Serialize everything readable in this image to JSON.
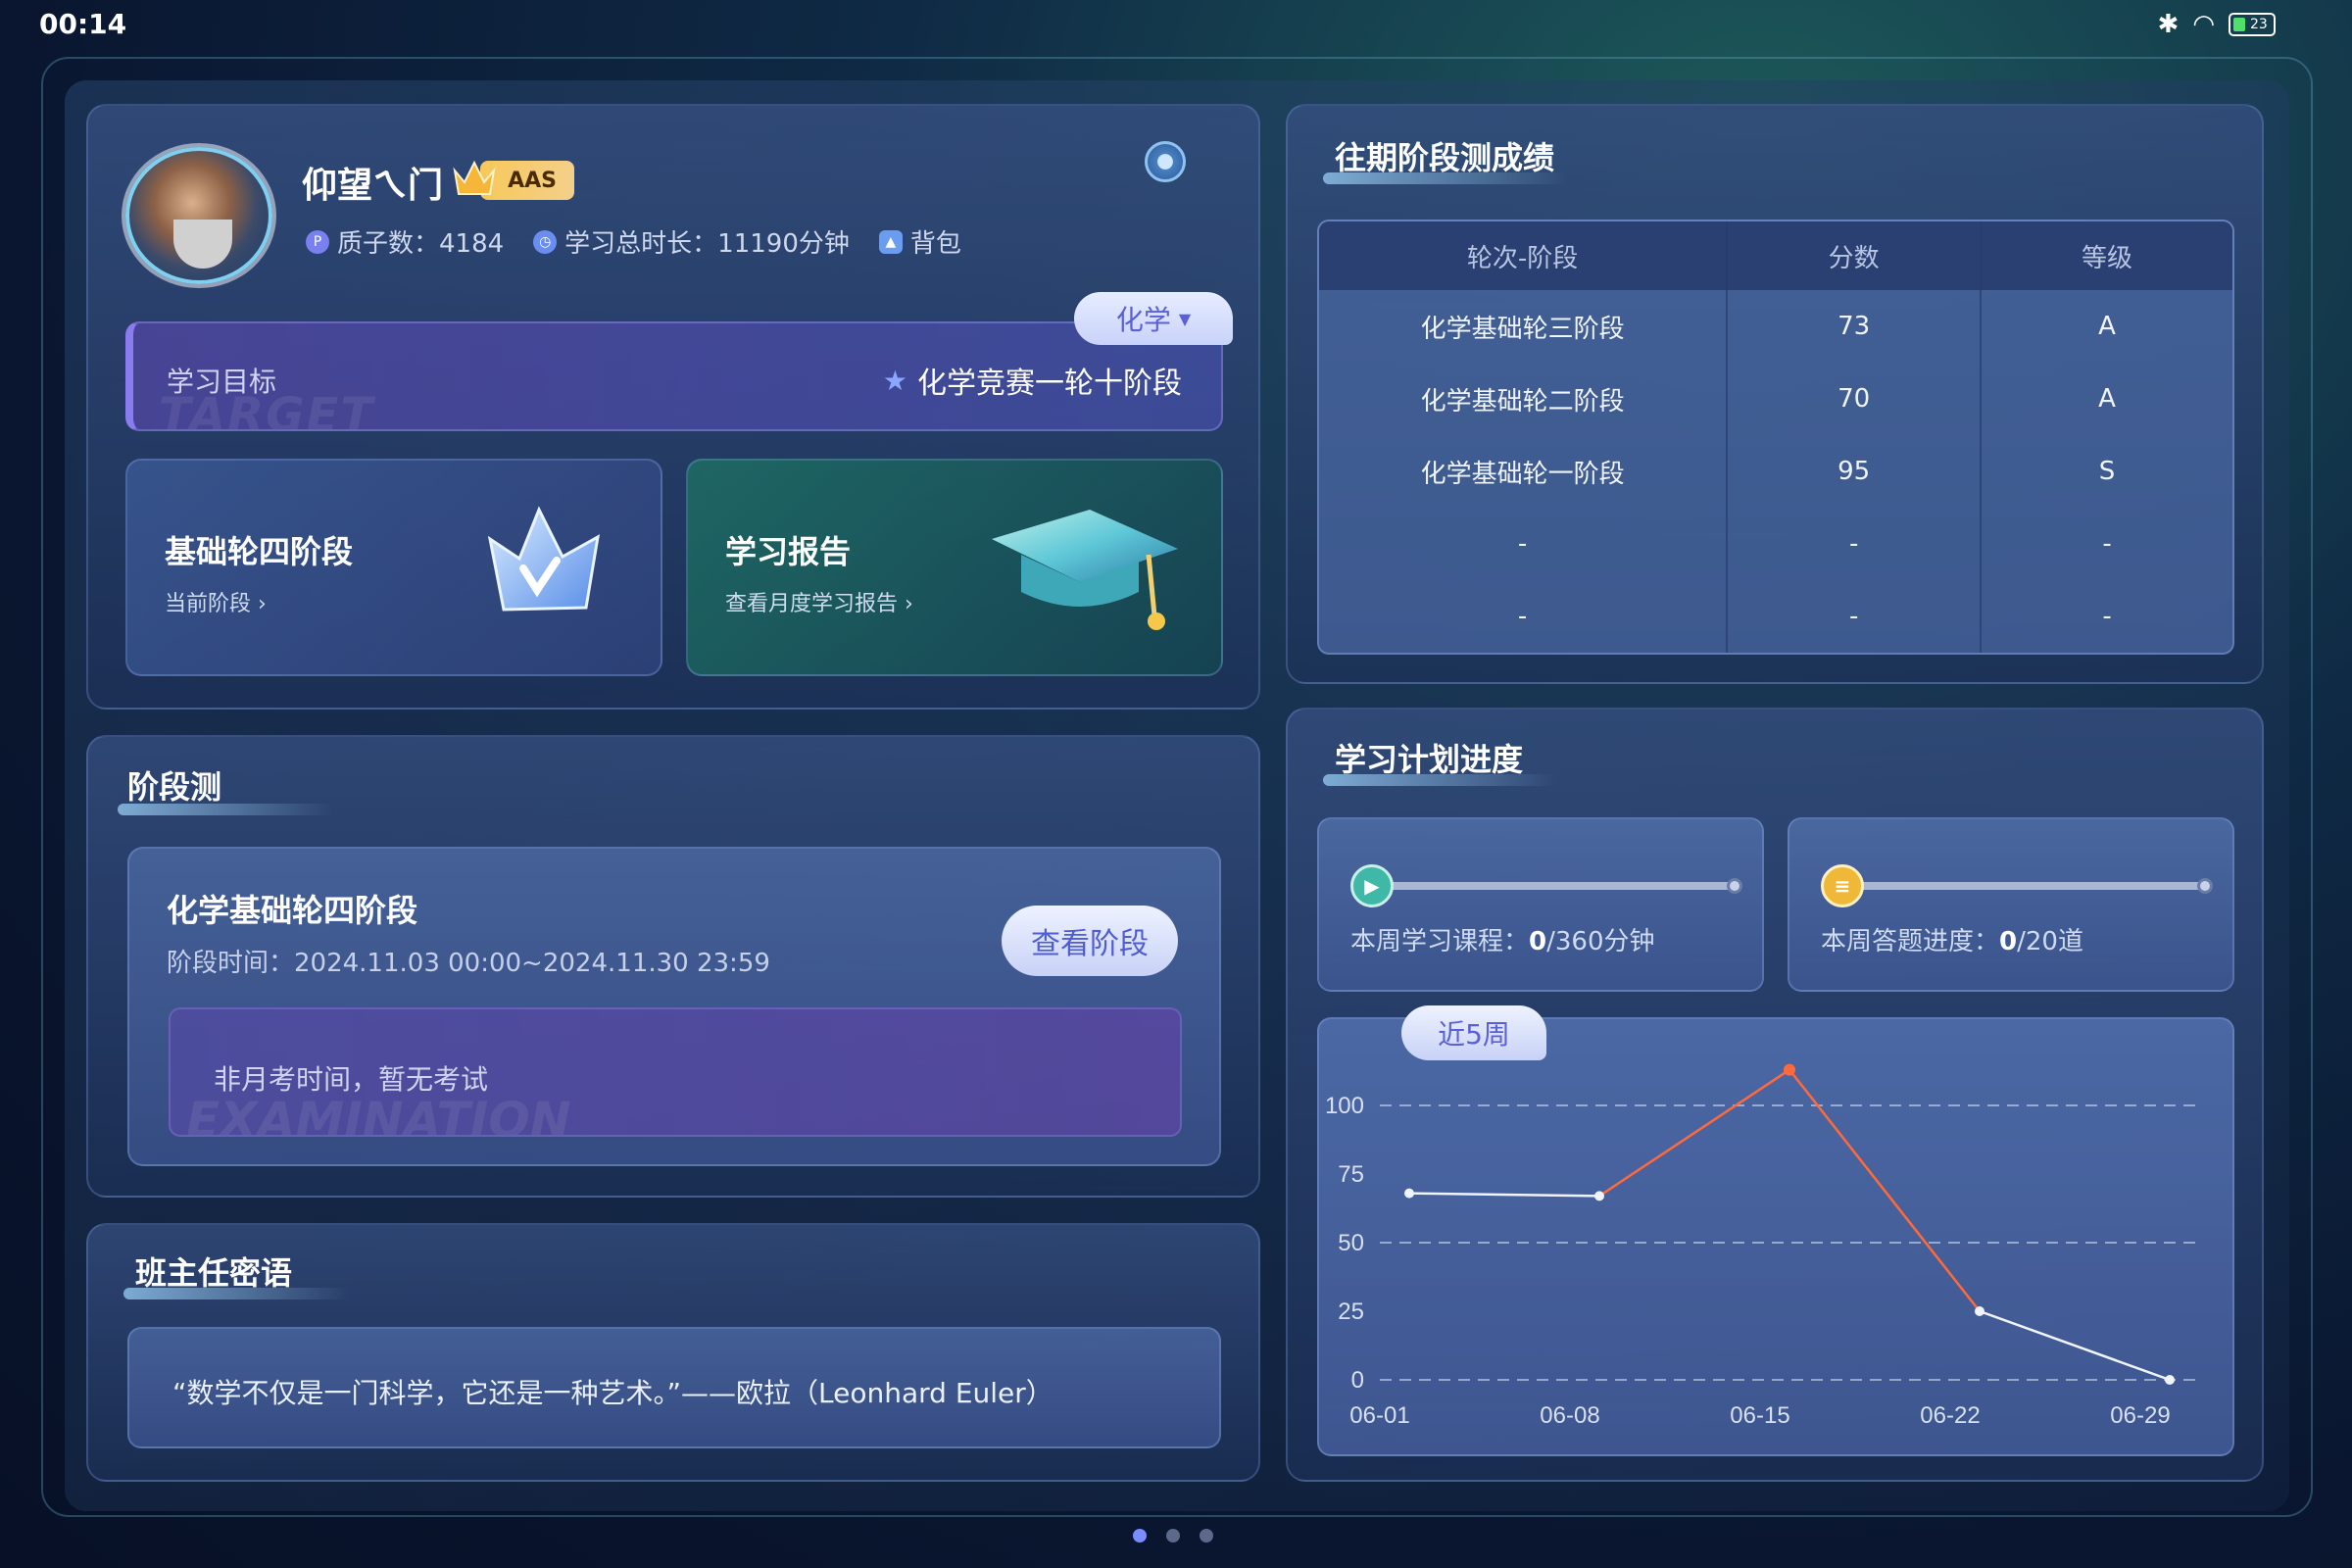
{
  "status_bar": {
    "time": "00:14",
    "battery": "23"
  },
  "profile": {
    "name": "仰望ㄟ门",
    "badge": "AAS",
    "stats": [
      {
        "icon": "quark-icon",
        "label": "质子数：4184"
      },
      {
        "icon": "clock-icon",
        "label": "学习总时长：11190分钟"
      },
      {
        "icon": "backpack-icon",
        "label": "背包"
      }
    ],
    "subject_select": "化学",
    "goal": {
      "label": "学习目标",
      "watermark": "TARGET",
      "value": "化学竞赛一轮十阶段"
    },
    "cards": [
      {
        "title": "基础轮四阶段",
        "sub": "当前阶段 ›"
      },
      {
        "title": "学习报告",
        "sub": "查看月度学习报告 ›"
      }
    ]
  },
  "exam": {
    "title": "阶段测",
    "name": "化学基础轮四阶段",
    "time": "阶段时间：2024.11.03 00:00~2024.11.30 23:59",
    "button": "查看阶段",
    "notice": "非月考时间，暂无考试",
    "watermark": "EXAMINATION"
  },
  "teacher": {
    "title": "班主任密语",
    "quote": "“数学不仅是一门科学，它还是一种艺术。”——欧拉（Leonhard Euler）"
  },
  "scores": {
    "title": "往期阶段测成绩",
    "headers": [
      "轮次-阶段",
      "分数",
      "等级"
    ],
    "rows": [
      [
        "化学基础轮三阶段",
        "73",
        "A"
      ],
      [
        "化学基础轮二阶段",
        "70",
        "A"
      ],
      [
        "化学基础轮一阶段",
        "95",
        "S"
      ],
      [
        "-",
        "-",
        "-"
      ],
      [
        "-",
        "-",
        "-"
      ]
    ]
  },
  "plan": {
    "title": "学习计划进度",
    "course": {
      "label": "本周学习课程：",
      "value": "0",
      "total": "/360分钟",
      "progress": 0
    },
    "quiz": {
      "label": "本周答题进度：",
      "value": "0",
      "total": "/20道",
      "progress": 0
    },
    "range": "近5周"
  },
  "chart_data": {
    "type": "line",
    "categories": [
      "06-01",
      "06-08",
      "06-15",
      "06-22",
      "06-29"
    ],
    "values": [
      68,
      67,
      113,
      25,
      0
    ],
    "yticks": [
      0,
      25,
      50,
      75,
      100
    ],
    "ylim": [
      0,
      100
    ],
    "highlight_color": "#ff6a3d",
    "line_color": "#f0f4ff"
  },
  "pager": {
    "count": 3,
    "active": 0
  }
}
